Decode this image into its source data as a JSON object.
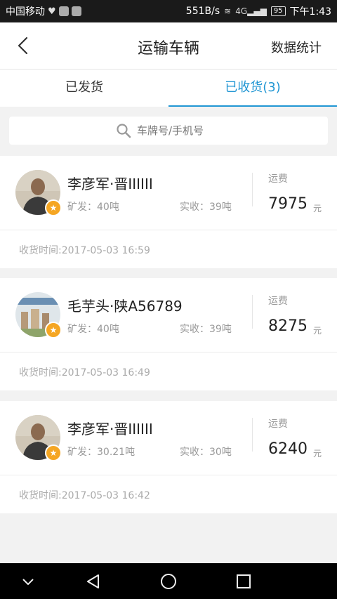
{
  "status_bar": {
    "carrier": "中国移动",
    "speed": "551B/s",
    "network": "4G",
    "battery": "95",
    "time": "下午1:43"
  },
  "header": {
    "title": "运输车辆",
    "stats_link": "数据统计"
  },
  "tabs": [
    {
      "label": "已发货",
      "active": false
    },
    {
      "label": "已收货(3)",
      "active": true
    }
  ],
  "search": {
    "placeholder": "车牌号/手机号"
  },
  "records": [
    {
      "driver": "李彦军·晋IIIIII",
      "dispatched": "矿发：40吨",
      "received": "实收：39吨",
      "fee_label": "运费",
      "fee": "7975",
      "fee_unit": "元",
      "time": "收货时间:2017-05-03 16:59",
      "avatar": "person-photo"
    },
    {
      "driver": "毛芋头·陕A56789",
      "dispatched": "矿发：40吨",
      "received": "实收：39吨",
      "fee_label": "运费",
      "fee": "8275",
      "fee_unit": "元",
      "time": "收货时间:2017-05-03 16:49",
      "avatar": "building-photo"
    },
    {
      "driver": "李彦军·晋IIIIII",
      "dispatched": "矿发：30.21吨",
      "received": "实收：30吨",
      "fee_label": "运费",
      "fee": "6240",
      "fee_unit": "元",
      "time": "收货时间:2017-05-03 16:42",
      "avatar": "person-photo"
    }
  ],
  "colors": {
    "accent": "#2196d3",
    "badge": "#f5a623"
  }
}
